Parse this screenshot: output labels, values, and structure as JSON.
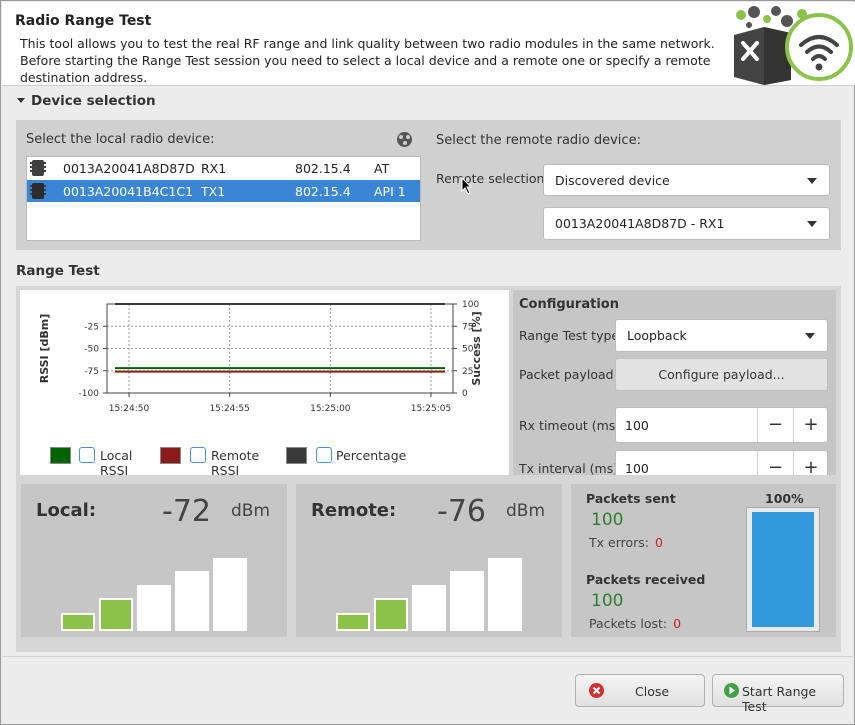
{
  "header": {
    "title": "Radio Range Test",
    "description": "This tool allows you to test the real RF range and link quality between two radio modules in the same network. Before starting the Range Test session you need to select a local device and a remote one or specify a remote destination address."
  },
  "device_selection": {
    "title": "Device selection",
    "local_label": "Select the local radio device:",
    "remote_label": "Select the remote radio device:",
    "remote_selection_label": "Remote selection:",
    "remote_selection_value": "Discovered device",
    "remote_device_value": "0013A20041A8D87D - RX1",
    "devices": [
      {
        "mac": "0013A20041A8D87D",
        "name": "RX1",
        "protocol": "802.15.4",
        "mode": "AT"
      },
      {
        "mac": "0013A20041B4C1C1",
        "name": "TX1",
        "protocol": "802.15.4",
        "mode": "API 1"
      }
    ]
  },
  "range_test": {
    "title": "Range Test",
    "chart_data": {
      "type": "line",
      "title": "",
      "xlabel": "",
      "ylabel": "RSSI [dBm]",
      "y2label": "Success [%]",
      "ylim": [
        -100,
        0
      ],
      "y2lim": [
        0,
        100
      ],
      "yticks": [
        "-25",
        "-50",
        "-75",
        "-100"
      ],
      "y2ticks": [
        "100",
        "75",
        "50",
        "25",
        "0"
      ],
      "xticks": [
        "15:24:50",
        "15:24:55",
        "15:25:00",
        "15:25:05"
      ],
      "grid": true,
      "series": [
        {
          "name": "Local RSSI",
          "axis": "left",
          "color": "#006400",
          "values": [
            -72,
            -72
          ]
        },
        {
          "name": "Remote RSSI",
          "axis": "left",
          "color": "#8b1a1a",
          "values": [
            -76,
            -76
          ]
        },
        {
          "name": "Percentage",
          "axis": "right",
          "color": "#3a3a3a",
          "values": [
            100,
            100
          ]
        }
      ]
    },
    "legend": {
      "local": "Local RSSI",
      "remote": "Remote RSSI",
      "percentage": "Percentage"
    },
    "config": {
      "title": "Configuration",
      "type_label": "Range Test type:",
      "type_value": "Loopback",
      "payload_label": "Packet payload:",
      "payload_button": "Configure payload...",
      "rx_timeout_label": "Rx timeout (ms):",
      "rx_timeout_value": "100",
      "tx_interval_label": "Tx interval (ms):",
      "tx_interval_value": "100",
      "minus": "−",
      "plus": "+"
    },
    "local": {
      "label": "Local:",
      "value": "-72",
      "unit": "dBm",
      "bars_on": 2
    },
    "remote": {
      "label": "Remote:",
      "value": "-76",
      "unit": "dBm",
      "bars_on": 2
    },
    "stats": {
      "sent_label": "Packets sent",
      "sent_value": "100",
      "tx_errors_label": "Tx errors:",
      "tx_errors_value": "0",
      "received_label": "Packets received",
      "received_value": "100",
      "lost_label": "Packets lost:",
      "lost_value": "0",
      "percent_label": "100%",
      "percent_fraction": 1.0
    }
  },
  "buttons": {
    "close": "Close",
    "start": "Start Range Test"
  },
  "colors": {
    "selection": "#3a86d4",
    "accent_green": "#8bc34a",
    "percent_bar": "#3399dd"
  }
}
